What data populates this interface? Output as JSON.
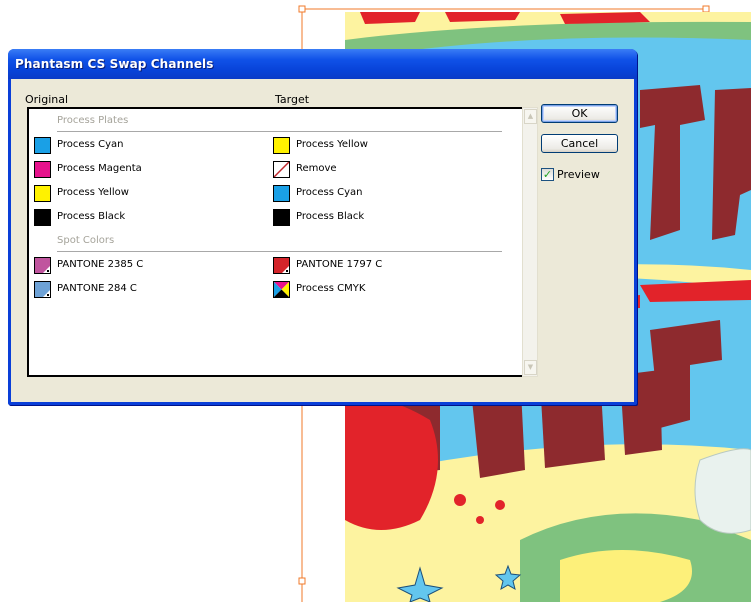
{
  "dialog": {
    "title": "Phantasm CS Swap Channels",
    "original_header": "Original",
    "target_header": "Target",
    "ok_label": "OK",
    "cancel_label": "Cancel",
    "preview_label": "Preview",
    "preview_checked": true
  },
  "sections": {
    "process_plates": "Process Plates",
    "spot_colors": "Spot Colors"
  },
  "process_rows": [
    {
      "original": {
        "label": "Process Cyan",
        "color": "#1aa0e6"
      },
      "target": {
        "label": "Process Yellow",
        "color": "#fff200"
      }
    },
    {
      "original": {
        "label": "Process Magenta",
        "color": "#e6128c"
      },
      "target": {
        "label": "Remove",
        "color": "remove"
      }
    },
    {
      "original": {
        "label": "Process Yellow",
        "color": "#fff200"
      },
      "target": {
        "label": "Process Cyan",
        "color": "#1aa0e6"
      }
    },
    {
      "original": {
        "label": "Process Black",
        "color": "#000000"
      },
      "target": {
        "label": "Process Black",
        "color": "#000000"
      }
    }
  ],
  "spot_rows": [
    {
      "original": {
        "label": "PANTONE 2385 C",
        "color": "#c0559e"
      },
      "target": {
        "label": "PANTONE 1797 C",
        "color": "#d3242a"
      }
    },
    {
      "original": {
        "label": "PANTONE 284 C",
        "color": "#6ea2d6"
      },
      "target": {
        "label": "Process CMYK",
        "color": "cmyk"
      }
    }
  ]
}
